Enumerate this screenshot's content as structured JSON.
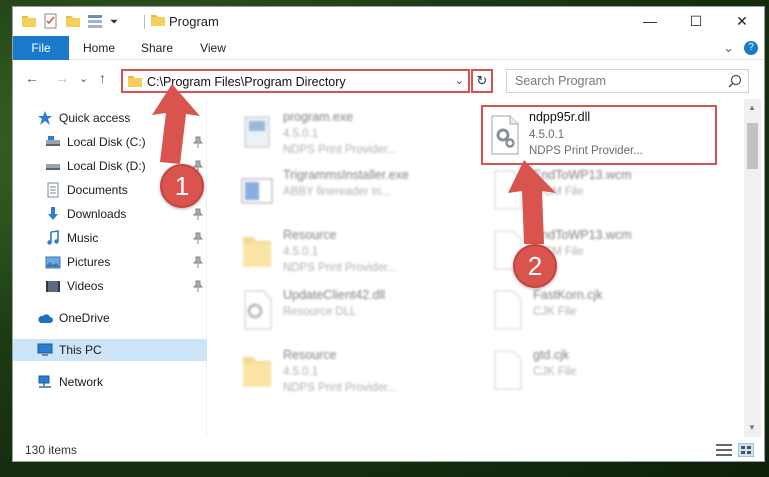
{
  "window": {
    "title": "Program",
    "controls": {
      "minimize": "—",
      "maximize": "☐",
      "close": "✕"
    }
  },
  "ribbon": {
    "tabs": [
      {
        "label": "File"
      },
      {
        "label": "Home"
      },
      {
        "label": "Share"
      },
      {
        "label": "View"
      }
    ],
    "expand": "⌄",
    "help": "?"
  },
  "navbar": {
    "back": "←",
    "forward": "→",
    "recent": "⌄",
    "up": "↑",
    "address": "C:\\Program Files\\Program Directory",
    "dropdown": "⌄",
    "refresh": "↻",
    "search_placeholder": "Search Program"
  },
  "sidebar": {
    "items": [
      {
        "label": "Quick access",
        "icon": "star-icon",
        "pinned": false
      },
      {
        "label": "Local Disk (C:)",
        "icon": "drive-icon",
        "pinned": true
      },
      {
        "label": "Local Disk (D:)",
        "icon": "drive-icon",
        "pinned": true
      },
      {
        "label": "Documents",
        "icon": "documents-icon",
        "pinned": true
      },
      {
        "label": "Downloads",
        "icon": "download-icon",
        "pinned": true
      },
      {
        "label": "Music",
        "icon": "music-icon",
        "pinned": true
      },
      {
        "label": "Pictures",
        "icon": "pictures-icon",
        "pinned": true
      },
      {
        "label": "Videos",
        "icon": "videos-icon",
        "pinned": true
      },
      {
        "label": "OneDrive",
        "icon": "cloud-icon",
        "pinned": false
      },
      {
        "label": "This PC",
        "icon": "computer-icon",
        "pinned": false,
        "selected": true
      },
      {
        "label": "Network",
        "icon": "network-icon",
        "pinned": false
      }
    ]
  },
  "files": {
    "left": [
      {
        "name": "program.exe",
        "line2": "4.5.0.1",
        "line3": "NDPS Print Provider...",
        "icon": "exe-icon"
      },
      {
        "name": "TrigrammsInstaller.exe",
        "line2": "ABBY finereader tri...",
        "line3": "",
        "icon": "installer-icon"
      },
      {
        "name": "Resource",
        "line2": "4.5.0.1",
        "line3": "NDPS Print Provider...",
        "icon": "folder-icon"
      },
      {
        "name": "UpdateClient42.dll",
        "line2": "Resource DLL",
        "line3": "",
        "icon": "dll-icon"
      },
      {
        "name": "Resource",
        "line2": "4.5.0.1",
        "line3": "NDPS Print Provider...",
        "icon": "folder-icon"
      }
    ],
    "right": [
      {
        "name": "ndpp95r.dll",
        "line2": "4.5.0.1",
        "line3": "NDPS Print Provider...",
        "icon": "dll-gear-icon"
      },
      {
        "name": "EndToWP13.wcm",
        "line2": "WCM File",
        "line3": "",
        "icon": "file-icon"
      },
      {
        "name": "EndToWP13.wcm",
        "line2": "WCM File",
        "line3": "",
        "icon": "file-icon"
      },
      {
        "name": "FastKorn.cjk",
        "line2": "CJK File",
        "line3": "",
        "icon": "file-icon"
      },
      {
        "name": "gtd.cjk",
        "line2": "CJK File",
        "line3": "",
        "icon": "file-icon"
      }
    ]
  },
  "status": {
    "count": "130 items"
  },
  "annotations": {
    "badge1": "1",
    "badge2": "2"
  },
  "colors": {
    "accent": "#1979ca",
    "highlight": "#d9534f",
    "selected": "#cce4f7"
  }
}
